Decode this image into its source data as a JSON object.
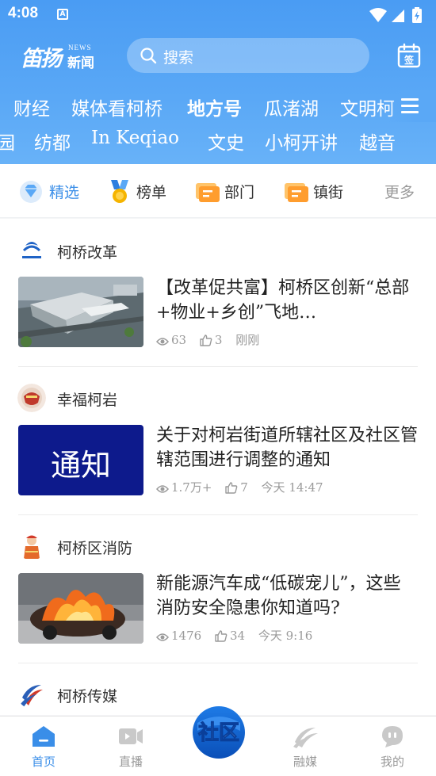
{
  "status_bar": {
    "time": "4:08",
    "notification_icon": "A"
  },
  "header": {
    "logo_main": "笛扬",
    "logo_news_en": "NEWS",
    "logo_news_cn": "新闻",
    "search_placeholder": "搜索",
    "sign_in_icon_text": "签"
  },
  "channels_row1": [
    "财经",
    "媒体看柯桥",
    "地方号",
    "瓜渚湖",
    "文明柯"
  ],
  "channels_row1_active": "地方号",
  "channels_row2": [
    "园",
    "纺都",
    "In Keqiao",
    "文史",
    "小柯开讲",
    "越音"
  ],
  "categories": [
    {
      "label": "精选",
      "icon": "diamond-icon",
      "selected": true
    },
    {
      "label": "榜单",
      "icon": "medal-icon",
      "selected": false
    },
    {
      "label": "部门",
      "icon": "department-icon",
      "selected": false
    },
    {
      "label": "镇街",
      "icon": "town-icon",
      "selected": false
    }
  ],
  "more_label": "更多",
  "feed": [
    {
      "source": "柯桥改革",
      "title": "【改革促共富】柯桥区创新“总部+物业+乡创”飞地…",
      "views": "63",
      "likes": "3",
      "time": "刚刚",
      "thumb_text": ""
    },
    {
      "source": "幸福柯岩",
      "title": "关于对柯岩街道所辖社区及社区管辖范围进行调整的通知",
      "views": "1.7万+",
      "likes": "7",
      "time": "今天 14:47",
      "thumb_text": "通知"
    },
    {
      "source": "柯桥区消防",
      "title": "新能源汽车成“低碳宠儿”，这些消防安全隐患你知道吗?",
      "views": "1476",
      "likes": "34",
      "time": "今天 9:16",
      "thumb_text": ""
    },
    {
      "source": "柯桥传媒",
      "title": "",
      "views": "",
      "likes": "",
      "time": "",
      "thumb_text": ""
    }
  ],
  "tabs": [
    {
      "label": "首页",
      "icon": "home-icon",
      "active": true
    },
    {
      "label": "直播",
      "icon": "live-video-icon",
      "active": false
    },
    {
      "label": "社区",
      "icon": "community-icon",
      "active": false
    },
    {
      "label": "融媒",
      "icon": "media-icon",
      "active": false
    },
    {
      "label": "我的",
      "icon": "profile-icon",
      "active": false
    }
  ],
  "colors": {
    "accent": "#3a8ee8",
    "header_top": "#4a9cf3",
    "notice_bg": "#0d1a8c"
  }
}
